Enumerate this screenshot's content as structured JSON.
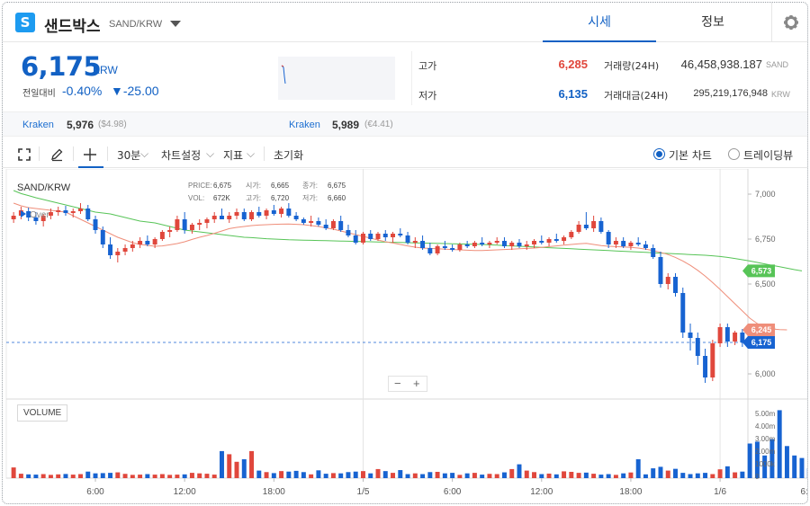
{
  "header": {
    "logo_glyph": "S",
    "coin_name": "샌드박스",
    "pair": "SAND/KRW",
    "tabs": [
      {
        "label": "시세",
        "active": true
      },
      {
        "label": "정보",
        "active": false
      }
    ]
  },
  "summary": {
    "price": "6,175",
    "unit": "KRW",
    "change_label": "전일대비",
    "change_pct": "-0.40%",
    "change_amt": "▼-25.00",
    "high_label": "고가",
    "high": "6,285",
    "low_label": "저가",
    "low": "6,135",
    "vol_label": "거래량(24H)",
    "vol_value": "46,458,938.187",
    "vol_unit": "SAND",
    "amt_label": "거래대금(24H)",
    "amt_value": "295,219,176,948",
    "amt_unit": "KRW"
  },
  "exchanges": [
    {
      "name": "Kraken",
      "price": "5,976",
      "sub": "($4.98)"
    },
    {
      "name": "Kraken",
      "price": "5,989",
      "sub": "(€4.41)"
    }
  ],
  "toolbar": {
    "interval": "30분",
    "settings": "차트설정",
    "indicators": "지표",
    "reset": "초기화",
    "mode_basic": "기본 차트",
    "mode_trading": "트레이딩뷰"
  },
  "colors": {
    "up": "#e0473c",
    "down": "#1763d1",
    "ma_short": "#ef8e7a",
    "ma_long": "#57c457",
    "accent": "#1261c4"
  },
  "chart_data": {
    "type": "candlestick",
    "title": "SAND/KRW",
    "overlay_label": "Over",
    "ohlc_legend": {
      "price_label": "PRICE:",
      "price": "6,675",
      "open_label": "시가:",
      "open": "6,665",
      "close_label": "종가:",
      "close": "6,675",
      "vol_label": "VOL:",
      "vol": "672K",
      "high_label": "고가:",
      "high": "6,720",
      "low_label": "저가:",
      "low": "6,660"
    },
    "y_ticks": [
      "7,000",
      "6,750",
      "6,500",
      "6,250",
      "6,000"
    ],
    "y_tick_values": [
      7000,
      6750,
      6500,
      6250,
      6000
    ],
    "y_range": [
      5900,
      7100
    ],
    "x_ticks": [
      "6:00",
      "12:00",
      "18:00",
      "1/5",
      "6:00",
      "12:00",
      "18:00",
      "1/6",
      "6:00"
    ],
    "x_tick_index": [
      11,
      23,
      35,
      47,
      59,
      71,
      83,
      95,
      107
    ],
    "price_tags": [
      {
        "label": "6,573",
        "value": 6573,
        "color": "#57c457"
      },
      {
        "label": "6,245",
        "value": 6245,
        "color": "#ef8e7a"
      },
      {
        "label": "6,175",
        "value": 6175,
        "color": "#1763d1"
      }
    ],
    "current_price": 6175,
    "volume_label": "VOLUME",
    "volume_ticks": [
      "5.00m",
      "4.00m",
      "3.00m",
      "2.00m",
      "1000k",
      "0"
    ],
    "volume_max": 5000000,
    "ma_long": [
      7020,
      7003,
      6992,
      6980,
      6970,
      6960,
      6950,
      6940,
      6930,
      6920,
      6910,
      6900,
      6895,
      6890,
      6880,
      6870,
      6860,
      6850,
      6845,
      6840,
      6830,
      6820,
      6810,
      6800,
      6795,
      6790,
      6785,
      6780,
      6775,
      6770,
      6765,
      6760,
      6758,
      6755,
      6752,
      6750,
      6748,
      6746,
      6745,
      6744,
      6743,
      6742,
      6741,
      6740,
      6739,
      6738,
      6737,
      6736,
      6735,
      6734,
      6733,
      6732,
      6731,
      6730,
      6729,
      6728,
      6727,
      6726,
      6725,
      6724,
      6723,
      6722,
      6721,
      6720,
      6718,
      6716,
      6714,
      6712,
      6710,
      6708,
      6706,
      6704,
      6702,
      6700,
      6698,
      6696,
      6694,
      6692,
      6690,
      6688,
      6686,
      6684,
      6682,
      6680,
      6678,
      6676,
      6674,
      6672,
      6670,
      6668,
      6666,
      6664,
      6662,
      6660,
      6657,
      6653,
      6648,
      6642,
      6635,
      6628,
      6620,
      6612,
      6604,
      6596,
      6588,
      6580,
      6573
    ],
    "ma_short": [
      6950,
      6935,
      6925,
      6920,
      6915,
      6910,
      6905,
      6900,
      6880,
      6860,
      6840,
      6820,
      6800,
      6780,
      6760,
      6745,
      6730,
      6720,
      6715,
      6710,
      6712,
      6718,
      6725,
      6735,
      6748,
      6760,
      6770,
      6782,
      6795,
      6808,
      6815,
      6820,
      6825,
      6828,
      6830,
      6832,
      6833,
      6834,
      6832,
      6830,
      6825,
      6820,
      6812,
      6805,
      6795,
      6785,
      6775,
      6765,
      6755,
      6745,
      6735,
      6728,
      6720,
      6712,
      6705,
      6700,
      6698,
      6696,
      6694,
      6692,
      6690,
      6688,
      6686,
      6686,
      6688,
      6690,
      6692,
      6694,
      6696,
      6698,
      6700,
      6704,
      6708,
      6712,
      6716,
      6720,
      6724,
      6726,
      6720,
      6714,
      6710,
      6708,
      6706,
      6704,
      6700,
      6694,
      6686,
      6676,
      6664,
      6648,
      6628,
      6604,
      6576,
      6544,
      6508,
      6470,
      6430,
      6390,
      6350,
      6310,
      6280,
      6260,
      6250,
      6246,
      6245
    ],
    "candles": [
      [
        6860,
        6900,
        6840,
        6880
      ],
      [
        6880,
        6930,
        6860,
        6910
      ],
      [
        6905,
        6925,
        6850,
        6870
      ],
      [
        6870,
        6900,
        6830,
        6850
      ],
      [
        6850,
        6890,
        6820,
        6880
      ],
      [
        6880,
        6920,
        6860,
        6900
      ],
      [
        6900,
        6930,
        6880,
        6910
      ],
      [
        6910,
        6935,
        6880,
        6895
      ],
      [
        6895,
        6920,
        6870,
        6905
      ],
      [
        6905,
        6950,
        6890,
        6920
      ],
      [
        6920,
        6940,
        6850,
        6860
      ],
      [
        6860,
        6880,
        6780,
        6800
      ],
      [
        6800,
        6820,
        6700,
        6720
      ],
      [
        6720,
        6760,
        6640,
        6660
      ],
      [
        6660,
        6700,
        6620,
        6680
      ],
      [
        6680,
        6720,
        6660,
        6700
      ],
      [
        6700,
        6740,
        6680,
        6720
      ],
      [
        6720,
        6760,
        6700,
        6740
      ],
      [
        6740,
        6770,
        6710,
        6720
      ],
      [
        6720,
        6760,
        6700,
        6750
      ],
      [
        6750,
        6800,
        6740,
        6790
      ],
      [
        6790,
        6820,
        6760,
        6800
      ],
      [
        6800,
        6880,
        6790,
        6860
      ],
      [
        6860,
        6900,
        6780,
        6800
      ],
      [
        6800,
        6840,
        6780,
        6830
      ],
      [
        6830,
        6860,
        6800,
        6840
      ],
      [
        6840,
        6870,
        6810,
        6860
      ],
      [
        6860,
        6900,
        6840,
        6880
      ],
      [
        6880,
        6920,
        6860,
        6860
      ],
      [
        6860,
        6900,
        6840,
        6880
      ],
      [
        6880,
        6920,
        6860,
        6900
      ],
      [
        6900,
        6920,
        6850,
        6860
      ],
      [
        6860,
        6910,
        6850,
        6900
      ],
      [
        6900,
        6930,
        6870,
        6880
      ],
      [
        6880,
        6920,
        6860,
        6910
      ],
      [
        6910,
        6940,
        6880,
        6890
      ],
      [
        6890,
        6930,
        6870,
        6920
      ],
      [
        6920,
        6950,
        6870,
        6880
      ],
      [
        6880,
        6900,
        6850,
        6860
      ],
      [
        6860,
        6870,
        6830,
        6840
      ],
      [
        6840,
        6880,
        6820,
        6850
      ],
      [
        6850,
        6870,
        6820,
        6830
      ],
      [
        6830,
        6860,
        6800,
        6810
      ],
      [
        6810,
        6860,
        6800,
        6850
      ],
      [
        6850,
        6880,
        6790,
        6800
      ],
      [
        6800,
        6830,
        6760,
        6770
      ],
      [
        6770,
        6800,
        6720,
        6730
      ],
      [
        6730,
        6790,
        6720,
        6780
      ],
      [
        6780,
        6800,
        6740,
        6750
      ],
      [
        6750,
        6790,
        6740,
        6780
      ],
      [
        6780,
        6800,
        6740,
        6760
      ],
      [
        6760,
        6790,
        6730,
        6780
      ],
      [
        6780,
        6810,
        6760,
        6770
      ],
      [
        6770,
        6790,
        6720,
        6730
      ],
      [
        6730,
        6760,
        6700,
        6740
      ],
      [
        6740,
        6770,
        6690,
        6700
      ],
      [
        6700,
        6730,
        6660,
        6670
      ],
      [
        6670,
        6720,
        6660,
        6710
      ],
      [
        6710,
        6740,
        6690,
        6700
      ],
      [
        6700,
        6720,
        6680,
        6690
      ],
      [
        6690,
        6730,
        6680,
        6720
      ],
      [
        6720,
        6740,
        6700,
        6710
      ],
      [
        6710,
        6740,
        6700,
        6730
      ],
      [
        6730,
        6760,
        6710,
        6720
      ],
      [
        6720,
        6740,
        6700,
        6730
      ],
      [
        6730,
        6760,
        6720,
        6740
      ],
      [
        6740,
        6760,
        6700,
        6710
      ],
      [
        6710,
        6740,
        6690,
        6730
      ],
      [
        6730,
        6750,
        6700,
        6710
      ],
      [
        6710,
        6740,
        6690,
        6720
      ],
      [
        6720,
        6750,
        6700,
        6740
      ],
      [
        6740,
        6770,
        6720,
        6730
      ],
      [
        6730,
        6760,
        6710,
        6750
      ],
      [
        6750,
        6780,
        6730,
        6740
      ],
      [
        6740,
        6770,
        6720,
        6760
      ],
      [
        6760,
        6800,
        6750,
        6790
      ],
      [
        6790,
        6850,
        6780,
        6830
      ],
      [
        6830,
        6900,
        6800,
        6810
      ],
      [
        6810,
        6880,
        6790,
        6850
      ],
      [
        6850,
        6870,
        6780,
        6790
      ],
      [
        6790,
        6800,
        6700,
        6720
      ],
      [
        6720,
        6760,
        6700,
        6740
      ],
      [
        6740,
        6760,
        6700,
        6710
      ],
      [
        6710,
        6740,
        6690,
        6730
      ],
      [
        6730,
        6760,
        6710,
        6720
      ],
      [
        6720,
        6740,
        6690,
        6700
      ],
      [
        6700,
        6720,
        6640,
        6650
      ],
      [
        6650,
        6680,
        6480,
        6500
      ],
      [
        6500,
        6560,
        6470,
        6540
      ],
      [
        6540,
        6560,
        6430,
        6450
      ],
      [
        6450,
        6480,
        6200,
        6230
      ],
      [
        6230,
        6280,
        6130,
        6200
      ],
      [
        6200,
        6230,
        6050,
        6100
      ],
      [
        6100,
        6140,
        5950,
        5980
      ],
      [
        5980,
        6190,
        5960,
        6170
      ],
      [
        6170,
        6280,
        6150,
        6260
      ],
      [
        6260,
        6280,
        6150,
        6180
      ],
      [
        6180,
        6240,
        6160,
        6230
      ],
      [
        6230,
        6250,
        6150,
        6175
      ]
    ],
    "volume": [
      850000,
      350000,
      300000,
      280000,
      320000,
      260000,
      300000,
      330000,
      280000,
      320000,
      520000,
      380000,
      400000,
      420000,
      460000,
      340000,
      260000,
      280000,
      320000,
      280000,
      320000,
      260000,
      280000,
      300000,
      420000,
      380000,
      350000,
      280000,
      2150000,
      1900000,
      1300000,
      1500000,
      2150000,
      600000,
      480000,
      400000,
      560000,
      520000,
      580000,
      480000,
      300000,
      620000,
      350000,
      400000,
      380000,
      480000,
      520000,
      560000,
      380000,
      720000,
      560000,
      420000,
      640000,
      320000,
      380000,
      320000,
      480000,
      500000,
      380000,
      420000,
      260000,
      380000,
      420000,
      280000,
      340000,
      320000,
      460000,
      720000,
      1100000,
      600000,
      480000,
      320000,
      360000,
      300000,
      540000,
      500000,
      420000,
      440000,
      350000,
      280000,
      320000,
      260000,
      380000,
      450000,
      1500000,
      300000,
      780000,
      900000,
      600000,
      740000,
      420000,
      320000,
      380000,
      420000,
      320000,
      700000,
      940000,
      460000,
      520000,
      2750000,
      2900000,
      1800000,
      3100000,
      5400000,
      2550000,
      1800000,
      1600000,
      780000,
      700000
    ]
  }
}
